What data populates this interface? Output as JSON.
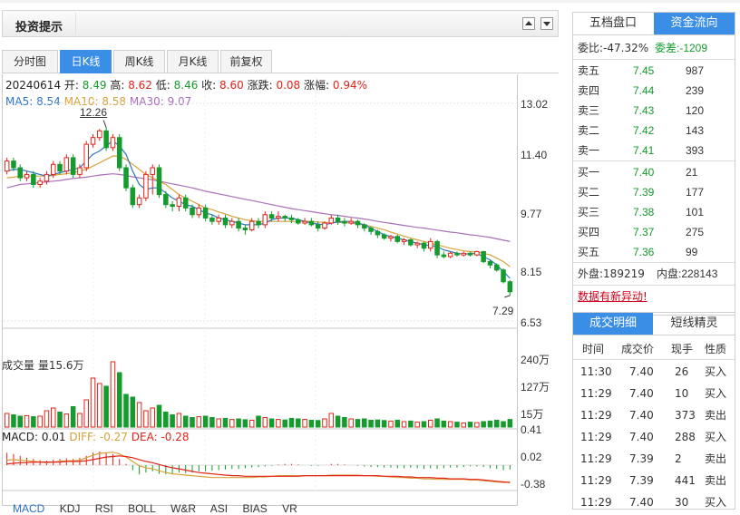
{
  "header": {
    "title": "投资提示"
  },
  "tabs": [
    "分时图",
    "日K线",
    "周K线",
    "月K线",
    "前复权"
  ],
  "active_tab": "日K线",
  "info": {
    "date": "20240614",
    "open_label": "开:",
    "open": "8.49",
    "high_label": "高:",
    "high": "8.62",
    "low_label": "低:",
    "low": "8.46",
    "close_label": "收:",
    "close": "8.60",
    "change_label": "涨跌:",
    "change": "0.08",
    "pct_label": "涨幅:",
    "pct": "0.94%"
  },
  "ma": {
    "ma5_label": "MA5:",
    "ma5": "8.54",
    "ma10_label": "MA10:",
    "ma10": "8.58",
    "ma30_label": "MA30:",
    "ma30": "9.07"
  },
  "price_axis": [
    "13.02",
    "11.40",
    "9.77",
    "8.15",
    "6.53"
  ],
  "high_marker": "12.26",
  "low_marker": "7.29",
  "volume": {
    "label": "成交量 量15.6万",
    "axis": [
      "240万",
      "127万",
      "15万"
    ]
  },
  "macd": {
    "label": "MACD: 0.01",
    "diff": "DIFF: -0.27",
    "dea": "DEA: -0.28",
    "axis": [
      "0.41",
      "0.02",
      "-0.38"
    ]
  },
  "indicators": [
    "MACD",
    "KDJ",
    "RSI",
    "BOLL",
    "W&R",
    "ASI",
    "BIAS",
    "VR"
  ],
  "active_indicator": "MACD",
  "colors": {
    "up": "#e2231a",
    "down": "#159b2e",
    "accent": "#3a8ee6",
    "ma5": "#2e75c6",
    "ma10": "#d8a23b",
    "ma30": "#a970b9"
  },
  "order_book": {
    "tabs": [
      "五档盘口",
      "资金流向"
    ],
    "active_tab": "资金流向",
    "wei_bi": "委比:-47.32%",
    "wei_cha": "委差:-1209",
    "asks": [
      {
        "label": "卖五",
        "price": "7.45",
        "vol": "987"
      },
      {
        "label": "卖四",
        "price": "7.44",
        "vol": "239"
      },
      {
        "label": "卖三",
        "price": "7.43",
        "vol": "120"
      },
      {
        "label": "卖二",
        "price": "7.42",
        "vol": "143"
      },
      {
        "label": "卖一",
        "price": "7.41",
        "vol": "393"
      }
    ],
    "bids": [
      {
        "label": "买一",
        "price": "7.40",
        "vol": "21"
      },
      {
        "label": "买二",
        "price": "7.39",
        "vol": "177"
      },
      {
        "label": "买三",
        "price": "7.38",
        "vol": "101"
      },
      {
        "label": "买四",
        "price": "7.37",
        "vol": "275"
      },
      {
        "label": "买五",
        "price": "7.36",
        "vol": "99"
      }
    ],
    "outer": "外盘:189219",
    "inner": "内盘:228143",
    "alert": "数据有新异动!"
  },
  "trades": {
    "tabs": [
      "成交明细",
      "短线精灵"
    ],
    "active_tab": "成交明细",
    "headers": [
      "时间",
      "成交价",
      "现手",
      "性质"
    ],
    "rows": [
      {
        "time": "11:30",
        "price": "7.40",
        "vol": "26",
        "type": "买入"
      },
      {
        "time": "11:29",
        "price": "7.40",
        "vol": "10",
        "type": "买入"
      },
      {
        "time": "11:29",
        "price": "7.40",
        "vol": "373",
        "type": "卖出"
      },
      {
        "time": "11:29",
        "price": "7.40",
        "vol": "288",
        "type": "买入"
      },
      {
        "time": "11:29",
        "price": "7.39",
        "vol": "2",
        "type": "卖出"
      },
      {
        "time": "11:29",
        "price": "7.39",
        "vol": "441",
        "type": "卖出"
      },
      {
        "time": "11:29",
        "price": "7.40",
        "vol": "30",
        "type": "买入"
      }
    ]
  },
  "chart_data": {
    "type": "candlestick",
    "ylim": [
      6.53,
      13.02
    ],
    "candles": [
      [
        11.0,
        11.3,
        11.4,
        10.9
      ],
      [
        11.3,
        11.1,
        11.4,
        11.0
      ],
      [
        11.1,
        10.8,
        11.2,
        10.7
      ],
      [
        10.8,
        10.9,
        11.0,
        10.7
      ],
      [
        10.9,
        10.6,
        11.0,
        10.5
      ],
      [
        10.6,
        10.7,
        10.8,
        10.5
      ],
      [
        10.7,
        10.9,
        11.0,
        10.6
      ],
      [
        10.9,
        11.2,
        11.3,
        10.8
      ],
      [
        11.2,
        11.0,
        11.3,
        10.9
      ],
      [
        11.0,
        11.4,
        11.5,
        10.9
      ],
      [
        11.4,
        10.9,
        11.5,
        10.8
      ],
      [
        10.9,
        11.1,
        11.2,
        10.8
      ],
      [
        11.1,
        11.8,
        11.9,
        11.0
      ],
      [
        11.8,
        12.0,
        12.1,
        11.7
      ],
      [
        12.0,
        12.2,
        12.26,
        11.9
      ],
      [
        12.2,
        11.7,
        12.3,
        11.6
      ],
      [
        11.7,
        12.0,
        12.1,
        11.6
      ],
      [
        12.0,
        11.1,
        12.1,
        11.0
      ],
      [
        11.1,
        10.5,
        11.2,
        10.4
      ],
      [
        10.5,
        10.0,
        10.6,
        9.9
      ],
      [
        10.0,
        10.2,
        10.3,
        9.9
      ],
      [
        10.2,
        10.9,
        11.0,
        10.1
      ],
      [
        10.9,
        11.1,
        11.2,
        10.3
      ],
      [
        11.1,
        10.3,
        11.2,
        10.2
      ],
      [
        10.3,
        10.0,
        10.4,
        9.9
      ],
      [
        10.0,
        9.95,
        10.1,
        9.8
      ],
      [
        9.95,
        10.2,
        10.3,
        9.8
      ],
      [
        10.2,
        9.9,
        10.3,
        9.8
      ],
      [
        9.9,
        9.7,
        10.0,
        9.6
      ],
      [
        9.7,
        9.9,
        10.0,
        9.6
      ],
      [
        9.9,
        9.6,
        10.0,
        9.5
      ],
      [
        9.6,
        9.5,
        9.7,
        9.4
      ],
      [
        9.5,
        9.6,
        9.7,
        9.4
      ],
      [
        9.6,
        9.4,
        9.7,
        9.3
      ],
      [
        9.4,
        9.5,
        9.6,
        9.3
      ],
      [
        9.5,
        9.3,
        9.6,
        9.2
      ],
      [
        9.3,
        9.25,
        9.4,
        9.1
      ],
      [
        9.25,
        9.5,
        9.6,
        9.2
      ],
      [
        9.5,
        9.4,
        9.6,
        9.3
      ],
      [
        9.4,
        9.7,
        9.8,
        9.3
      ],
      [
        9.7,
        9.6,
        9.8,
        9.5
      ],
      [
        9.6,
        9.65,
        9.8,
        9.5
      ],
      [
        9.65,
        9.6,
        9.7,
        9.5
      ],
      [
        9.6,
        9.55,
        9.7,
        9.45
      ],
      [
        9.55,
        9.45,
        9.6,
        9.4
      ],
      [
        9.45,
        9.5,
        9.6,
        9.4
      ],
      [
        9.5,
        9.4,
        9.6,
        9.35
      ],
      [
        9.4,
        9.3,
        9.5,
        9.2
      ],
      [
        9.3,
        9.45,
        9.5,
        9.25
      ],
      [
        9.45,
        9.6,
        9.7,
        9.4
      ],
      [
        9.6,
        9.5,
        9.7,
        9.4
      ],
      [
        9.5,
        9.45,
        9.6,
        9.35
      ],
      [
        9.45,
        9.5,
        9.6,
        9.4
      ],
      [
        9.5,
        9.4,
        9.55,
        9.3
      ],
      [
        9.4,
        9.3,
        9.45,
        9.2
      ],
      [
        9.3,
        9.2,
        9.35,
        9.1
      ],
      [
        9.2,
        9.1,
        9.25,
        9.0
      ],
      [
        9.1,
        9.0,
        9.15,
        8.95
      ],
      [
        9.0,
        9.05,
        9.1,
        8.9
      ],
      [
        9.05,
        8.9,
        9.1,
        8.85
      ],
      [
        8.9,
        8.95,
        9.0,
        8.8
      ],
      [
        8.95,
        8.8,
        9.0,
        8.75
      ],
      [
        8.8,
        8.85,
        8.9,
        8.7
      ],
      [
        8.85,
        8.7,
        8.9,
        8.6
      ],
      [
        8.7,
        8.9,
        9.0,
        8.6
      ],
      [
        8.9,
        8.5,
        8.95,
        8.4
      ],
      [
        8.5,
        8.45,
        8.6,
        8.4
      ],
      [
        8.45,
        8.55,
        8.6,
        8.4
      ],
      [
        8.55,
        8.5,
        8.6,
        8.45
      ],
      [
        8.5,
        8.55,
        8.6,
        8.45
      ],
      [
        8.55,
        8.5,
        8.6,
        8.45
      ],
      [
        8.5,
        8.6,
        8.62,
        8.46
      ],
      [
        8.6,
        8.3,
        8.62,
        8.25
      ],
      [
        8.3,
        8.2,
        8.35,
        8.1
      ],
      [
        8.2,
        8.05,
        8.25,
        8.0
      ],
      [
        8.05,
        7.7,
        8.1,
        7.65
      ],
      [
        7.7,
        7.4,
        7.75,
        7.29
      ]
    ],
    "ma5": [
      11.0,
      11.05,
      11.05,
      11.0,
      10.95,
      10.9,
      10.85,
      10.9,
      10.95,
      11.0,
      11.05,
      11.1,
      11.3,
      11.5,
      11.6,
      11.75,
      11.9,
      11.75,
      11.5,
      11.0,
      10.6,
      10.45,
      10.5,
      10.5,
      10.35,
      10.2,
      10.1,
      10.0,
      9.95,
      9.85,
      9.75,
      9.7,
      9.6,
      9.55,
      9.5,
      9.45,
      9.4,
      9.4,
      9.4,
      9.45,
      9.55,
      9.6,
      9.6,
      9.6,
      9.55,
      9.5,
      9.45,
      9.42,
      9.4,
      9.45,
      9.48,
      9.5,
      9.5,
      9.45,
      9.4,
      9.3,
      9.2,
      9.1,
      9.05,
      9.0,
      8.95,
      8.9,
      8.85,
      8.8,
      8.78,
      8.75,
      8.65,
      8.6,
      8.55,
      8.52,
      8.54,
      8.54,
      8.45,
      8.35,
      8.2,
      8.0,
      7.8
    ],
    "ma10": [
      10.8,
      10.82,
      10.85,
      10.85,
      10.85,
      10.85,
      10.85,
      10.87,
      10.9,
      10.92,
      10.95,
      11.0,
      11.05,
      11.15,
      11.25,
      11.35,
      11.45,
      11.45,
      11.35,
      11.2,
      11.05,
      10.9,
      10.8,
      10.7,
      10.6,
      10.45,
      10.3,
      10.2,
      10.1,
      10.0,
      9.9,
      9.85,
      9.78,
      9.72,
      9.65,
      9.6,
      9.55,
      9.52,
      9.5,
      9.5,
      9.5,
      9.5,
      9.5,
      9.5,
      9.5,
      9.5,
      9.5,
      9.48,
      9.47,
      9.47,
      9.47,
      9.46,
      9.45,
      9.42,
      9.4,
      9.35,
      9.3,
      9.25,
      9.18,
      9.12,
      9.06,
      9.0,
      8.95,
      8.9,
      8.85,
      8.8,
      8.75,
      8.7,
      8.66,
      8.62,
      8.6,
      8.58,
      8.55,
      8.5,
      8.4,
      8.3,
      8.15
    ],
    "ma30": [
      10.5,
      10.55,
      10.6,
      10.62,
      10.64,
      10.66,
      10.68,
      10.7,
      10.72,
      10.75,
      10.78,
      10.8,
      10.82,
      10.85,
      10.88,
      10.9,
      10.92,
      10.9,
      10.87,
      10.83,
      10.8,
      10.77,
      10.74,
      10.7,
      10.66,
      10.62,
      10.58,
      10.54,
      10.5,
      10.45,
      10.4,
      10.36,
      10.32,
      10.28,
      10.24,
      10.2,
      10.16,
      10.12,
      10.08,
      10.04,
      10.0,
      9.96,
      9.92,
      9.88,
      9.85,
      9.82,
      9.79,
      9.76,
      9.73,
      9.7,
      9.68,
      9.65,
      9.62,
      9.6,
      9.57,
      9.54,
      9.5,
      9.47,
      9.44,
      9.41,
      9.38,
      9.35,
      9.32,
      9.3,
      9.27,
      9.24,
      9.21,
      9.18,
      9.16,
      9.13,
      9.1,
      9.08,
      9.05,
      9.02,
      8.98,
      8.94,
      8.9
    ],
    "volume_ylim": [
      0,
      240
    ],
    "volumes": [
      50,
      45,
      40,
      42,
      38,
      40,
      60,
      70,
      55,
      48,
      75,
      50,
      100,
      180,
      160,
      150,
      240,
      200,
      120,
      110,
      90,
      60,
      70,
      80,
      55,
      45,
      50,
      40,
      35,
      38,
      40,
      35,
      30,
      32,
      28,
      30,
      27,
      25,
      40,
      35,
      30,
      28,
      26,
      32,
      30,
      28,
      25,
      24,
      30,
      50,
      40,
      35,
      30,
      28,
      30,
      25,
      26,
      24,
      22,
      25,
      20,
      22,
      18,
      20,
      25,
      30,
      22,
      20,
      18,
      15,
      18,
      16,
      20,
      22,
      25,
      20,
      28
    ],
    "macd_ylim": [
      -0.38,
      0.41
    ],
    "macd_hist": [
      0.2,
      0.18,
      0.15,
      0.12,
      0.1,
      0.08,
      0.07,
      0.09,
      0.1,
      0.11,
      0.1,
      0.12,
      0.15,
      0.2,
      0.22,
      0.2,
      0.18,
      0.1,
      0.02,
      -0.08,
      -0.15,
      -0.12,
      -0.1,
      -0.14,
      -0.15,
      -0.14,
      -0.12,
      -0.13,
      -0.12,
      -0.1,
      -0.1,
      -0.09,
      -0.08,
      -0.07,
      -0.06,
      -0.06,
      -0.05,
      -0.04,
      -0.03,
      -0.02,
      -0.01,
      0.01,
      0.02,
      0.02,
      0.01,
      0.0,
      -0.01,
      -0.01,
      0.0,
      0.02,
      0.02,
      0.01,
      0.0,
      -0.01,
      -0.02,
      -0.03,
      -0.03,
      -0.04,
      -0.04,
      -0.05,
      -0.05,
      -0.04,
      -0.05,
      -0.06,
      -0.05,
      -0.06,
      -0.05,
      -0.04,
      -0.04,
      -0.03,
      -0.02,
      -0.02,
      -0.03,
      -0.05,
      -0.06,
      -0.08,
      -0.07
    ],
    "diff": [
      0.08,
      0.09,
      0.08,
      0.07,
      0.06,
      0.05,
      0.04,
      0.05,
      0.06,
      0.07,
      0.07,
      0.08,
      0.12,
      0.16,
      0.19,
      0.2,
      0.21,
      0.18,
      0.13,
      0.06,
      -0.01,
      -0.04,
      -0.06,
      -0.09,
      -0.12,
      -0.14,
      -0.15,
      -0.16,
      -0.17,
      -0.18,
      -0.19,
      -0.2,
      -0.2,
      -0.2,
      -0.2,
      -0.2,
      -0.2,
      -0.2,
      -0.19,
      -0.19,
      -0.18,
      -0.17,
      -0.17,
      -0.17,
      -0.17,
      -0.17,
      -0.17,
      -0.17,
      -0.17,
      -0.16,
      -0.16,
      -0.16,
      -0.16,
      -0.16,
      -0.17,
      -0.17,
      -0.18,
      -0.18,
      -0.19,
      -0.2,
      -0.2,
      -0.21,
      -0.21,
      -0.22,
      -0.22,
      -0.23,
      -0.23,
      -0.23,
      -0.23,
      -0.23,
      -0.24,
      -0.24,
      -0.25,
      -0.26,
      -0.27,
      -0.28,
      -0.27
    ],
    "dea": [
      0.02,
      0.03,
      0.04,
      0.04,
      0.05,
      0.05,
      0.05,
      0.05,
      0.05,
      0.06,
      0.06,
      0.06,
      0.07,
      0.09,
      0.11,
      0.13,
      0.14,
      0.15,
      0.14,
      0.12,
      0.09,
      0.06,
      0.04,
      0.01,
      -0.02,
      -0.04,
      -0.06,
      -0.08,
      -0.1,
      -0.12,
      -0.13,
      -0.14,
      -0.15,
      -0.16,
      -0.17,
      -0.17,
      -0.18,
      -0.18,
      -0.18,
      -0.18,
      -0.18,
      -0.18,
      -0.18,
      -0.18,
      -0.18,
      -0.17,
      -0.17,
      -0.17,
      -0.17,
      -0.17,
      -0.17,
      -0.17,
      -0.17,
      -0.17,
      -0.17,
      -0.17,
      -0.17,
      -0.18,
      -0.18,
      -0.18,
      -0.19,
      -0.19,
      -0.2,
      -0.2,
      -0.2,
      -0.21,
      -0.21,
      -0.22,
      -0.22,
      -0.22,
      -0.23,
      -0.23,
      -0.24,
      -0.25,
      -0.26,
      -0.27,
      -0.28
    ]
  }
}
